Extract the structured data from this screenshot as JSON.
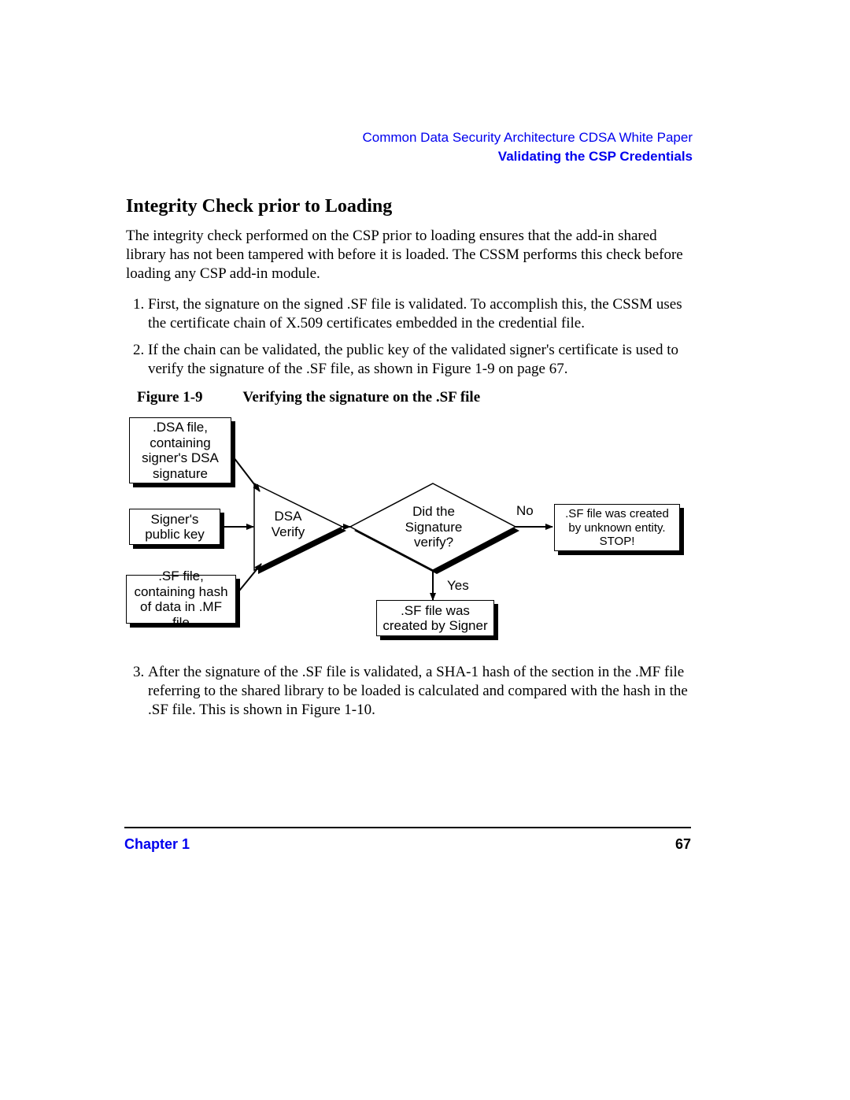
{
  "header": {
    "doc_title": "Common Data Security Architecture CDSA White Paper",
    "section": "Validating the CSP Credentials"
  },
  "title": "Integrity Check prior to Loading",
  "intro": "The integrity check performed on the CSP prior to loading ensures that the add-in shared library has not been tampered with before it is loaded.  The CSSM performs this check before loading any CSP add-in module.",
  "steps": [
    "First, the signature on the signed .SF file is validated.  To accomplish this, the CSSM uses the certificate chain of X.509 certificates embedded in the credential file.",
    "If the chain can be validated, the public key of the validated signer's certificate is used to verify the signature of the .SF file, as shown in Figure 1-9 on page  67."
  ],
  "figure": {
    "label": "Figure 1-9",
    "caption": "Verifying the signature on the .SF file"
  },
  "diagram": {
    "dsa_file": ".DSA file,\ncontaining\nsigner's DSA\nsignature",
    "pubkey": "Signer's\npublic key",
    "sf_file": ".SF file,\ncontaining hash\nof data in .MF file",
    "verify": "DSA\nVerify",
    "decision": "Did the\nSignature\nverify?",
    "no": "No",
    "yes": "Yes",
    "stop": ".SF file was created\nby unknown entity.\nSTOP!",
    "ok": ".SF file was\ncreated by Signer"
  },
  "step3": "After the signature of the .SF file is validated, a SHA-1 hash of the section in the .MF file referring to the shared library to be loaded is calculated and compared with the hash in the .SF file. This is shown in Figure 1-10.",
  "footer": {
    "chapter": "Chapter 1",
    "page": "67"
  }
}
